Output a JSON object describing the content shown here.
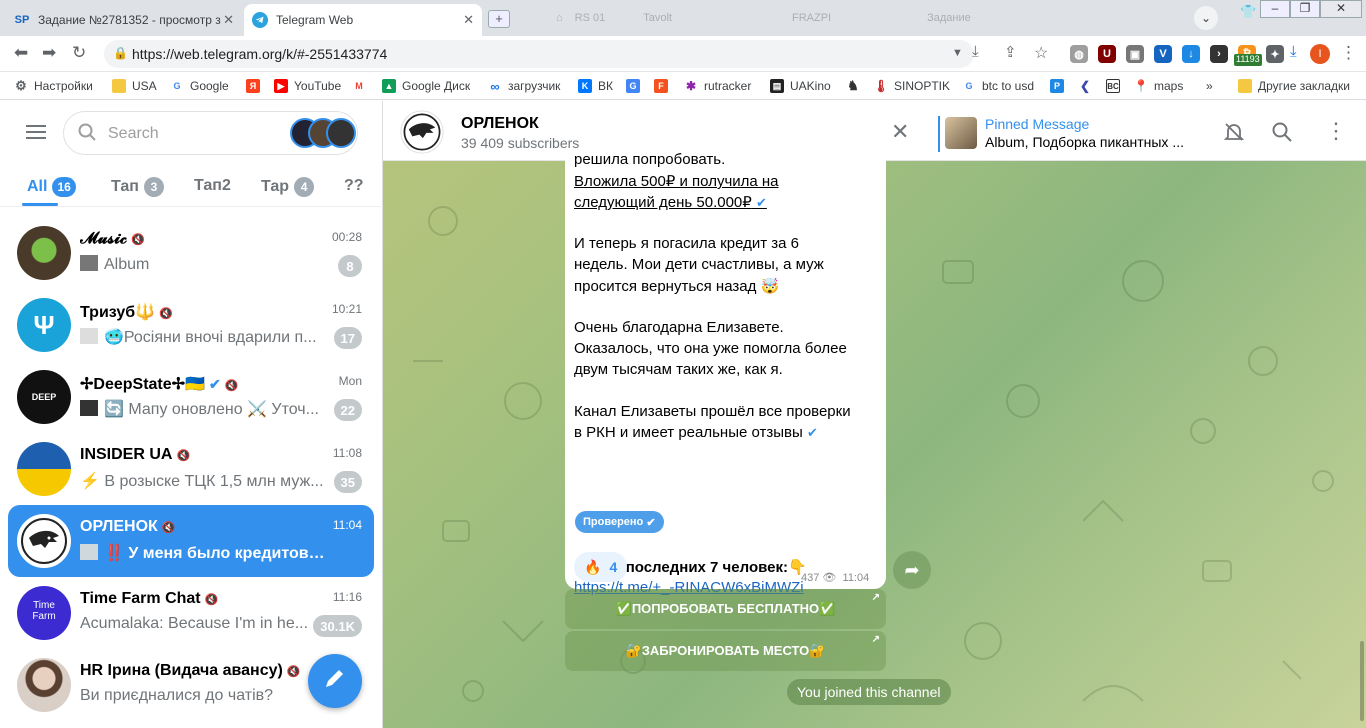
{
  "browser": {
    "tabs": [
      {
        "title": "Задание №2781352 - просмотр з",
        "favicon": "SP"
      },
      {
        "title": "Telegram Web",
        "favicon": "telegram-icon"
      }
    ],
    "ghost_tabs": [
      "",
      "RS 01",
      "Tavolt",
      "",
      "",
      "FRAZPI",
      "",
      "Задание"
    ],
    "url": "https://web.telegram.org/k/#-2551433774",
    "extension_badge": "11193",
    "profile_initial": "I",
    "bookmarks": [
      {
        "label": "Настройки",
        "icon": "gear-icon",
        "color": "#5f6368"
      },
      {
        "label": "USA",
        "icon": "folder-icon",
        "color": "#f5c842"
      },
      {
        "label": "Google",
        "icon": "google-icon",
        "color": "#4285f4"
      },
      {
        "label": "",
        "icon": "yandex-icon",
        "color": "#fc3f1d"
      },
      {
        "label": "YouTube",
        "icon": "youtube-icon",
        "color": "#ff0000"
      },
      {
        "label": "",
        "icon": "gmail-icon",
        "color": "#ea4335"
      },
      {
        "label": "Google Диск",
        "icon": "drive-icon",
        "color": "#0f9d58"
      },
      {
        "label": "загрузчик",
        "icon": "infinity-icon",
        "color": "#1a73e8"
      },
      {
        "label": "ВК",
        "icon": "vk-icon",
        "color": "#0077ff"
      },
      {
        "label": "",
        "icon": "translate-icon",
        "color": "#4285f4"
      },
      {
        "label": "",
        "icon": "f-icon",
        "color": "#f4511e"
      },
      {
        "label": "rutracker",
        "icon": "rutracker-icon",
        "color": "#8e24aa"
      },
      {
        "label": "UAKino",
        "icon": "film-icon",
        "color": "#222"
      },
      {
        "label": "",
        "icon": "chess-icon",
        "color": "#333"
      },
      {
        "label": "SINOPTIK",
        "icon": "thermometer-icon",
        "color": "#c62828"
      },
      {
        "label": "btc to usd",
        "icon": "google-icon",
        "color": "#4285f4"
      },
      {
        "label": "",
        "icon": "p-icon",
        "color": "#1e88e5"
      },
      {
        "label": "",
        "icon": "arrow-icon",
        "color": "#3949ab"
      },
      {
        "label": "",
        "icon": "bc-icon",
        "color": "#333"
      },
      {
        "label": "maps",
        "icon": "maps-icon",
        "color": "#34a853"
      }
    ],
    "other_bookmarks": "Другие закладки",
    "more_bookmarks": "»"
  },
  "telegram": {
    "search_placeholder": "Search",
    "folders": [
      {
        "label": "All",
        "count": "16",
        "active": true
      },
      {
        "label": "Тап",
        "count": "3",
        "active": false
      },
      {
        "label": "Тап2",
        "count": "",
        "active": false
      },
      {
        "label": "Тар",
        "count": "4",
        "active": false
      },
      {
        "label": "??",
        "count": "",
        "active": false
      }
    ],
    "chats": [
      {
        "name": "𝓜𝓾𝓼𝓲𝓬",
        "time": "00:28",
        "preview": "Album",
        "badge": "8",
        "selected": false,
        "avatar_color": "#4a3a2a"
      },
      {
        "name": "Тризуб🔱",
        "time": "10:21",
        "preview": "🥶Росіяни вночі вдарили п...",
        "badge": "17",
        "selected": false,
        "avatar_color": "#1aa3d9"
      },
      {
        "name": "✢DeepState✢🇺🇦",
        "time": "Mon",
        "preview": "🔄 Мапу оновлено ⚔️ Уточ...",
        "badge": "22",
        "selected": false,
        "avatar_color": "#111"
      },
      {
        "name": "INSIDER UA",
        "time": "11:08",
        "preview": "⚡ В розыске ТЦК 1,5 млн муж...",
        "badge": "35",
        "selected": false,
        "avatar_color": "#1f5fb0"
      },
      {
        "name": "ОРЛЕНОК",
        "time": "11:04",
        "preview": "‼️ У меня было кредитов на 3 м...",
        "badge": "",
        "selected": true,
        "avatar_color": "#fff"
      },
      {
        "name": "Time Farm Chat",
        "time": "11:16",
        "preview": "Acumalaka: Because I'm in he...",
        "badge": "30.1K",
        "selected": false,
        "avatar_color": "#3c2bd1"
      },
      {
        "name": "HR Ірина (Видача авансу)",
        "time": "",
        "preview": "Ви приєдналися до чатів?",
        "badge": "",
        "selected": false,
        "avatar_color": "#c9b8a8"
      }
    ],
    "channel": {
      "title": "ОРЛЕНОК",
      "subscribers": "39 409 subscribers",
      "pinned_title": "Pinned Message",
      "pinned_text": "Album, Подборка пикантных ..."
    },
    "message": {
      "lines": [
        "решила попробовать.",
        "Вложила 500₽ и получила на",
        "следующий день 50.000₽",
        "И теперь я погасила кредит за 6",
        "недель. Мои дети счастливы, а муж",
        "просится вернуться назад 🤯",
        "Очень благодарна Елизавете.",
        "Оказалось, что она уже помогла более",
        "двум тысячам таких же, как я.",
        "Канал Елизаветы прошёл все проверки",
        "в РКН и имеет реальные отзывы",
        "Берем последних 7 человек:👇",
        "https://t.me/+_-RINACW6xBiMWZi"
      ],
      "verified_badge": "Проверено",
      "reaction_emoji": "🔥",
      "reaction_count": "4",
      "views": "437",
      "time": "11:04",
      "buttons": [
        "✅ПОПРОБОВАТЬ БЕСПЛАТНО✅",
        "🔐ЗАБРОНИРОВАТЬ МЕСТО🔐"
      ]
    },
    "service_message": "You joined this channel"
  }
}
